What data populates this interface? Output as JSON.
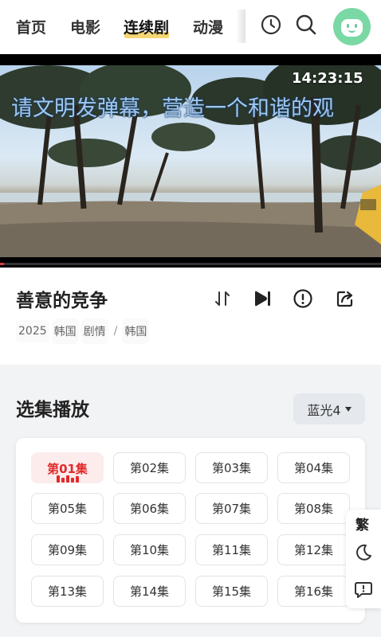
{
  "nav": {
    "items": [
      {
        "label": "首页",
        "active": false
      },
      {
        "label": "电影",
        "active": false
      },
      {
        "label": "连续剧",
        "active": true
      },
      {
        "label": "动漫",
        "active": false
      }
    ],
    "icons": [
      "history-icon",
      "search-icon",
      "avatar"
    ]
  },
  "player": {
    "danmaku_text": "请文明发弹幕，营造一个和谐的观",
    "clock": "14:23:15",
    "progress": 0.01
  },
  "show": {
    "title": "善意的竞争",
    "tags": [
      "2025",
      "韩国",
      "剧情",
      "/",
      "韩国"
    ],
    "actions": [
      "sort-icon",
      "next-episode-icon",
      "report-icon",
      "share-icon"
    ]
  },
  "episodes": {
    "section_title": "选集播放",
    "source_label": "蓝光4",
    "list": [
      "第01集",
      "第02集",
      "第03集",
      "第04集",
      "第05集",
      "第06集",
      "第07集",
      "第08集",
      "第09集",
      "第10集",
      "第11集",
      "第12集",
      "第13集",
      "第14集",
      "第15集",
      "第16集"
    ],
    "active_index": 0
  },
  "side_tools": {
    "traditional_label": "繁",
    "icons": [
      "moon-icon",
      "feedback-icon"
    ]
  },
  "colors": {
    "accent_red": "#e02a2a",
    "nav_underline": "#f7d774",
    "avatar_green": "#7ad8a5",
    "danmaku_blue": "#9ec7f0"
  }
}
